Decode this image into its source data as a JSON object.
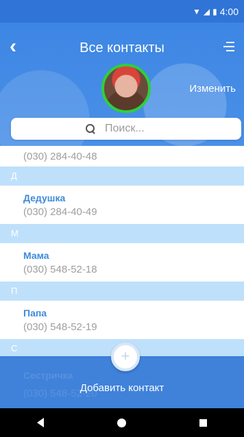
{
  "status_bar": {
    "time": "4:00",
    "wifi_icon": "wifi-icon",
    "signal_icon": "signal-icon",
    "battery_icon": "battery-icon"
  },
  "header": {
    "title": "Все контакты",
    "back_icon": "back-arrow-icon",
    "menu_icon": "menu-icon",
    "edit_label": "Изменить"
  },
  "search": {
    "placeholder": "Поиск...",
    "icon": "search-icon"
  },
  "contacts": {
    "top_phone": "(030) 284-40-48",
    "sections": [
      {
        "letter": "Д",
        "name": "Дедушка",
        "phone": "(030) 284-40-49"
      },
      {
        "letter": "М",
        "name": "Мама",
        "phone": "(030) 548-52-18"
      },
      {
        "letter": "П",
        "name": "Папа",
        "phone": "(030) 548-52-19"
      },
      {
        "letter": "С",
        "name": "Сестричка",
        "phone": "(030) 548-52-20"
      }
    ]
  },
  "add_contact": {
    "label": "Добавить контакт",
    "icon_glyph": "+"
  },
  "nav_bar": {
    "back_icon": "nav-back-icon",
    "home_icon": "nav-home-icon",
    "recents_icon": "nav-recents-icon"
  },
  "colors": {
    "primary": "#2f74d6",
    "section": "#bfe0fb",
    "name": "#3d8ad9",
    "avatar_ring": "#2fcf3a"
  }
}
